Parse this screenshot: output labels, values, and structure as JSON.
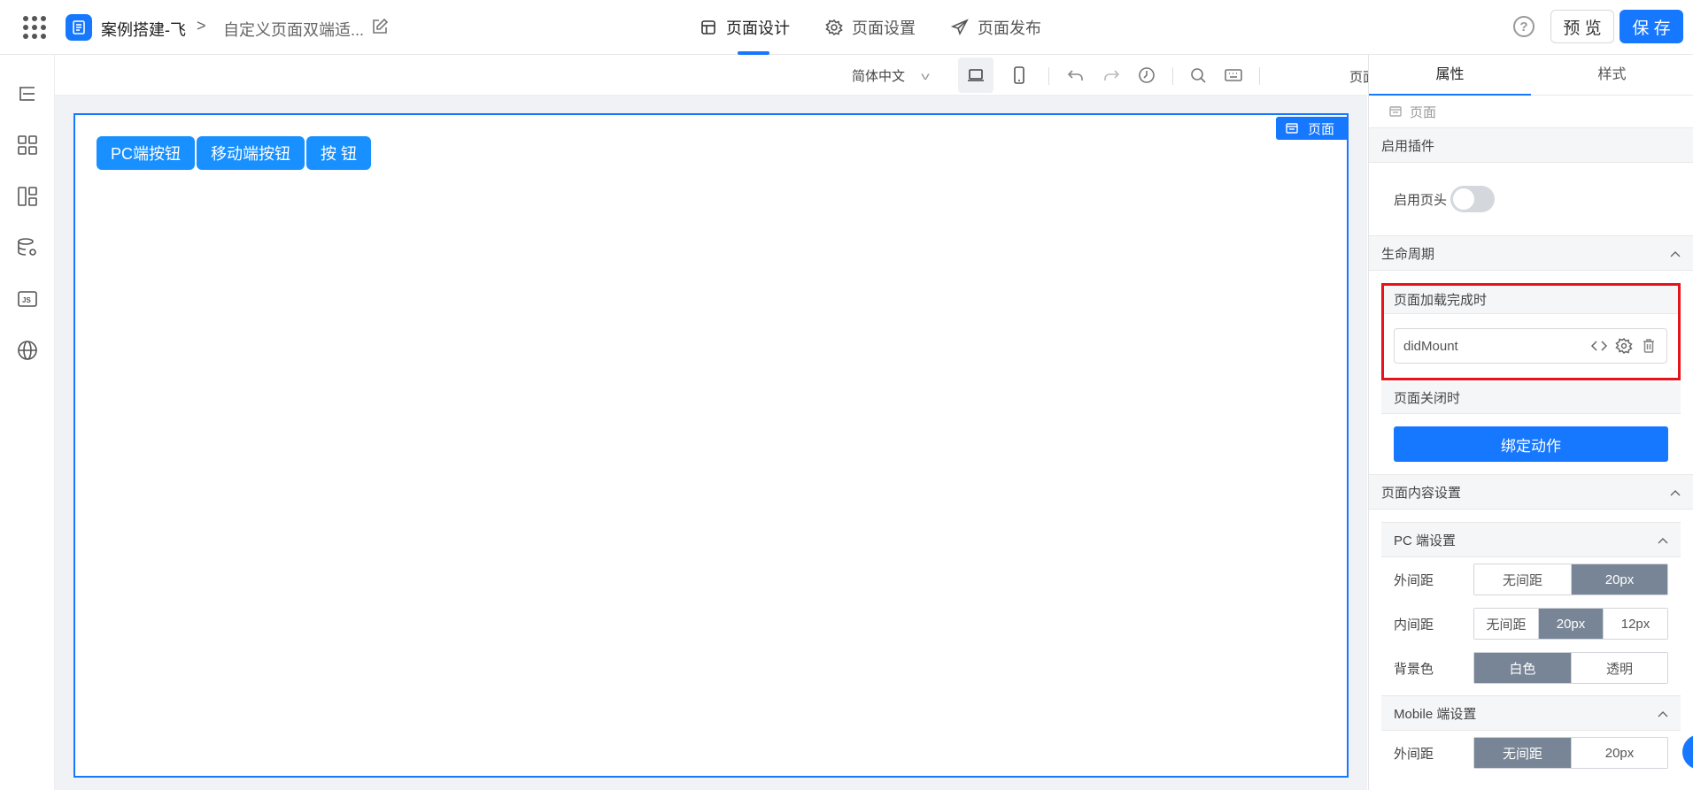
{
  "header": {
    "app_name": "案例搭建-飞",
    "breadcrumb_separator": ">",
    "page_name": "自定义页面双端适...",
    "tabs": [
      {
        "label": "页面设计",
        "icon": "page-design-icon"
      },
      {
        "label": "页面设置",
        "icon": "gear-icon"
      },
      {
        "label": "页面发布",
        "icon": "send-icon"
      }
    ],
    "help": "?",
    "preview_label": "预 览",
    "save_label": "保 存"
  },
  "toolbar": {
    "language": "简体中文",
    "page_attr_label": "页面属性"
  },
  "canvas": {
    "page_tag": "页面",
    "buttons": [
      "PC端按钮",
      "移动端按钮",
      "按 钮"
    ]
  },
  "right_panel": {
    "tabs": [
      "属性",
      "样式"
    ],
    "crumb": "页面",
    "plugins": {
      "title": "启用插件",
      "enable_header_label": "启用页头",
      "enable_header_on": false
    },
    "lifecycle": {
      "title": "生命周期",
      "on_load": "页面加载完成时",
      "on_load_action": "didMount",
      "on_close": "页面关闭时",
      "bind_action": "绑定动作"
    },
    "content_settings": {
      "title": "页面内容设置",
      "pc": {
        "title": "PC 端设置",
        "margin_label": "外间距",
        "margin_options": [
          "无间距",
          "20px"
        ],
        "padding_label": "内间距",
        "padding_options": [
          "无间距",
          "20px",
          "12px"
        ],
        "bg_label": "背景色",
        "bg_options": [
          "白色",
          "透明"
        ]
      },
      "mobile": {
        "title": "Mobile 端设置",
        "margin_label": "外间距",
        "margin_options": [
          "无间距",
          "20px"
        ]
      }
    }
  },
  "colors": {
    "accent": "#1677ff",
    "canvas_button": "#1890ff",
    "segment_selected": "#788596",
    "highlight_box": "#e6131a"
  }
}
